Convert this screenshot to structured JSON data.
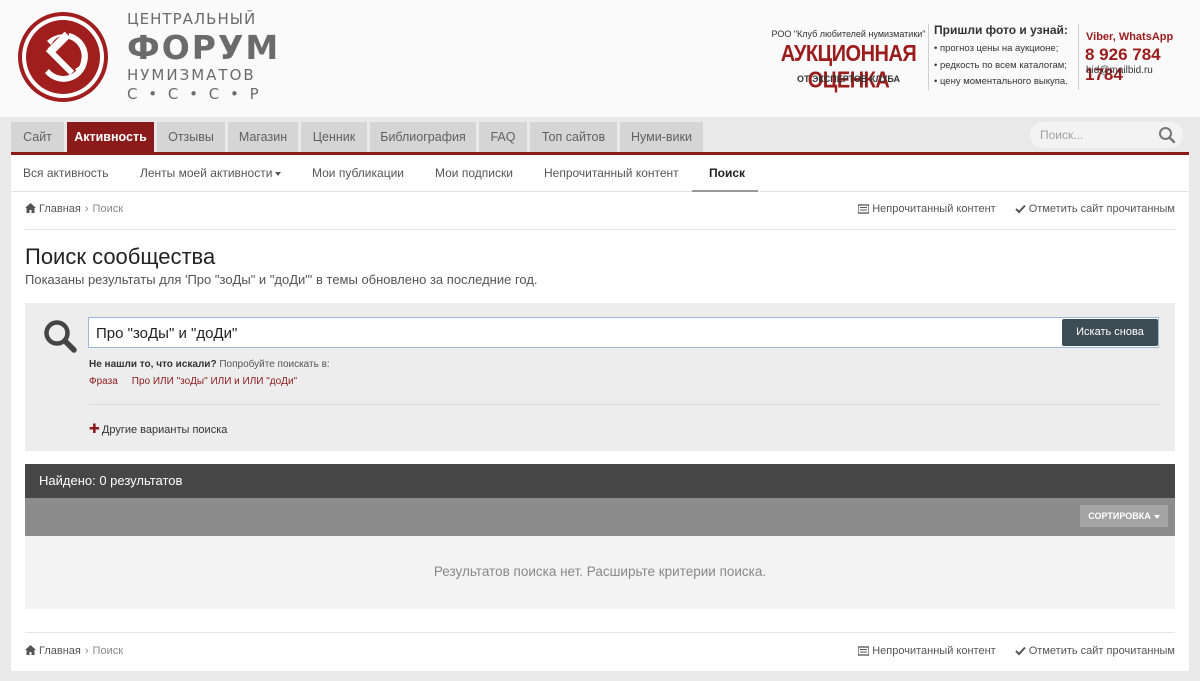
{
  "logo": {
    "line1": "ЦЕНТРАЛЬНЫЙ",
    "line2": "ФОРУМ",
    "line3": "НУМИЗМАТОВ",
    "line4": "С • С • С • Р",
    "emblem_color": "#a11e1e"
  },
  "ad": {
    "org": "РОО \"Клуб любителей нумизматики\"",
    "title": "АУКЦИОННАЯ ОЦЕНКА",
    "subtitle": "ОТ ЭКСПЕРТОВ КЛУБА",
    "send_title": "Пришли фото и узнай:",
    "list": [
      "• прогноз цены на аукционе;",
      "• редкость по всем каталогам;",
      "• цену моментального выкупа."
    ],
    "viber": "Viber, WhatsApp",
    "phone": "8 926 784 1784",
    "email": "bid@mailbid.ru"
  },
  "nav": {
    "tabs": [
      {
        "label": "Сайт"
      },
      {
        "label": "Активность"
      },
      {
        "label": "Отзывы"
      },
      {
        "label": "Магазин"
      },
      {
        "label": "Ценник"
      },
      {
        "label": "Библиография"
      },
      {
        "label": "FAQ"
      },
      {
        "label": "Топ сайтов"
      },
      {
        "label": "Нуми-вики"
      }
    ],
    "active_tab": "Активность",
    "search_placeholder": "Поиск...",
    "accent": "#8b1a1a"
  },
  "subnav": {
    "items": [
      {
        "label": "Вся активность"
      },
      {
        "label": "Ленты моей активности"
      },
      {
        "label": "Мои публикации"
      },
      {
        "label": "Мои подписки"
      },
      {
        "label": "Непрочитанный контент"
      },
      {
        "label": "Поиск"
      }
    ],
    "active": "Поиск"
  },
  "breadcrumb": {
    "home": "Главная",
    "current": "Поиск",
    "unread": "Непрочитанный контент",
    "mark_read": "Отметить сайт прочитанным"
  },
  "page": {
    "title": "Поиск сообщества",
    "description": "Показаны результаты для 'Про \"зоДы\" и \"доДи\"' в темы обновлено за последние год."
  },
  "search": {
    "query": "Про \"зоДы\" и \"доДи\"",
    "clear": "×",
    "button": "Искать снова",
    "hint_bold": "Не нашли то, что искали?",
    "hint_rest": " Попробуйте поискать в:",
    "suggestions": [
      "Фраза",
      "Про ИЛИ \"зоДы\" ИЛИ и ИЛИ \"доДи\""
    ],
    "more_plus": "✚",
    "more": "Другие варианты поиска"
  },
  "results": {
    "header": "Найдено: 0 результатов",
    "sort": "СОРТИРОВКА",
    "empty": "Результатов поиска нет. Расширьте критерии поиска."
  }
}
